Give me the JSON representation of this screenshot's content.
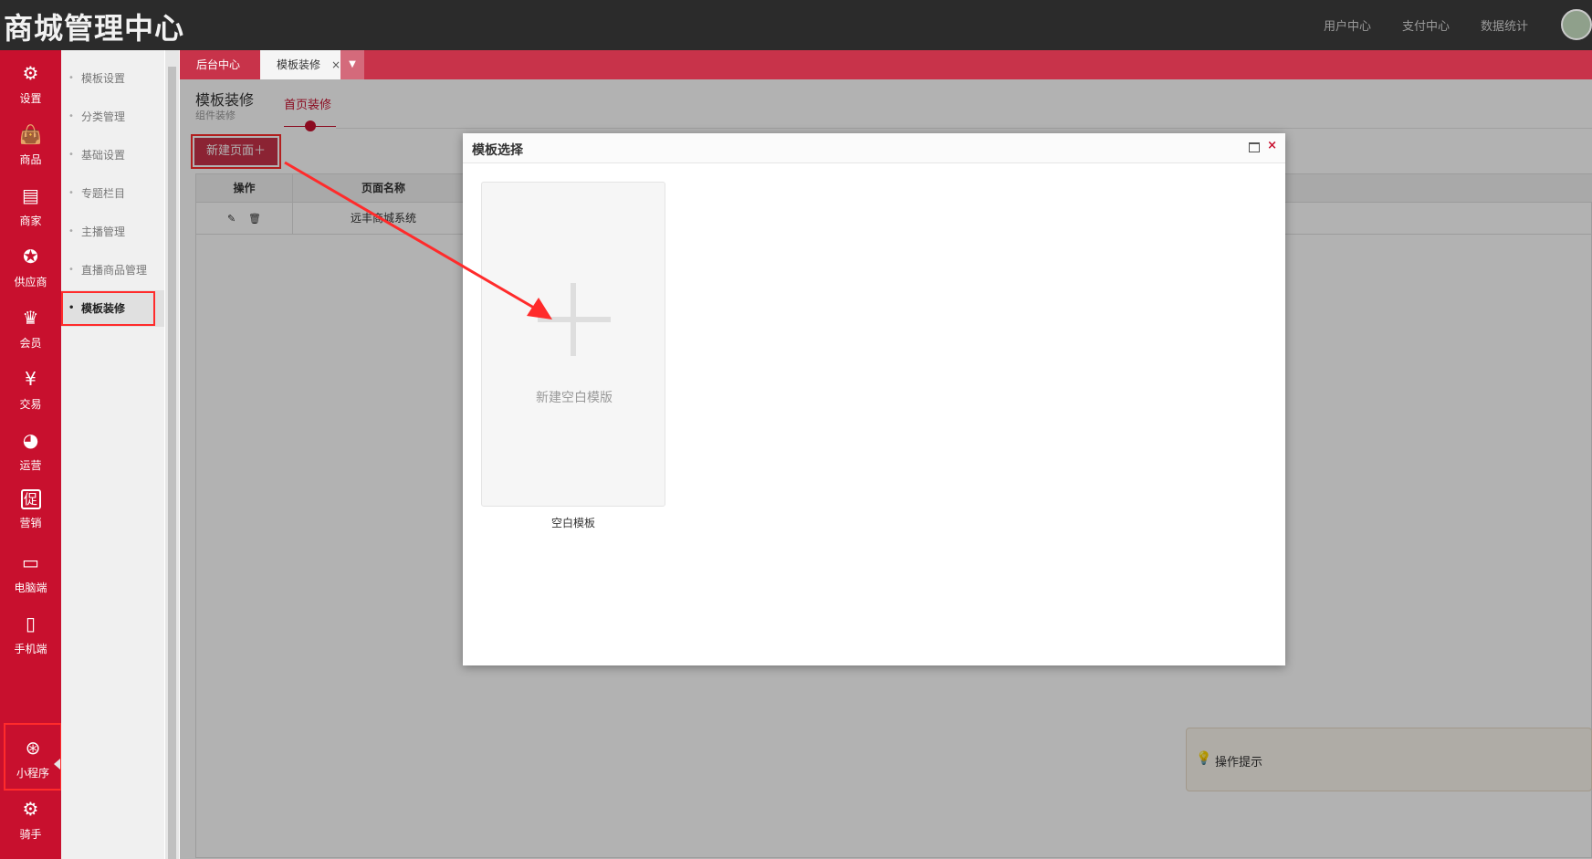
{
  "header": {
    "brand": "商城管理中心",
    "links": [
      "用户中心",
      "支付中心",
      "数据统计"
    ]
  },
  "sidebar_main": [
    {
      "label": "设置",
      "icon": "gear-icon"
    },
    {
      "label": "商品",
      "icon": "shopping-bag-icon"
    },
    {
      "label": "商家",
      "icon": "store-icon"
    },
    {
      "label": "供应商",
      "icon": "ribbon-icon"
    },
    {
      "label": "会员",
      "icon": "crown-icon"
    },
    {
      "label": "交易",
      "icon": "yen-icon"
    },
    {
      "label": "运营",
      "icon": "pie-chart-icon"
    },
    {
      "label": "营销",
      "icon": "promo-icon"
    },
    {
      "label": "电脑端",
      "icon": "monitor-icon"
    },
    {
      "label": "手机端",
      "icon": "phone-icon"
    },
    {
      "label": "小程序",
      "icon": "mini-program-icon"
    },
    {
      "label": "骑手",
      "icon": "gear-icon"
    }
  ],
  "sidebar_sub": [
    "模板设置",
    "分类管理",
    "基础设置",
    "专题栏目",
    "主播管理",
    "直播商品管理",
    "模板装修"
  ],
  "tabs": {
    "home": "后台中心",
    "current": "模板装修",
    "close": "×",
    "more": "▼"
  },
  "page": {
    "title": "模板装修",
    "subtitle": "组件装修",
    "subtab": "首页装修",
    "new_button": "新建页面＋"
  },
  "table": {
    "headers": [
      "操作",
      "页面名称"
    ],
    "rows": [
      {
        "name": "远丰商城系统",
        "edit_icon": "✎",
        "delete_icon": "🗑"
      }
    ]
  },
  "tips": {
    "label": "操作提示"
  },
  "modal": {
    "title": "模板选择",
    "close": "×",
    "card_text": "新建空白模版",
    "card_caption": "空白模板"
  },
  "colors": {
    "primary": "#c8102e",
    "tab_bar": "#c8334a",
    "header_bg": "#2b2b2b",
    "annotation": "#ff2b2b"
  }
}
